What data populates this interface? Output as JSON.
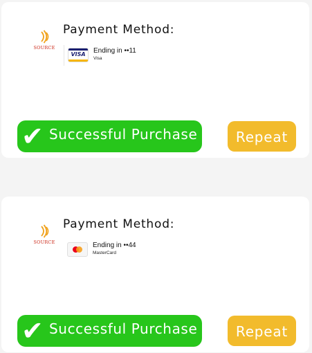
{
  "orders": [
    {
      "logo_text": "SOURCE",
      "title": "Payment Method:",
      "card_icon": "visa-card-icon",
      "card_icon_text": "VISA",
      "ending": "Ending in ••11",
      "brand": "Visa",
      "status": "Successful Purchase",
      "status_icon": "checkmark-icon",
      "repeat_label": "Repeat"
    },
    {
      "logo_text": "SOURCE",
      "title": "Payment Method:",
      "card_icon": "mastercard-icon",
      "ending": "Ending in ••44",
      "brand": "MasterCard",
      "status": "Successful Purchase",
      "status_icon": "checkmark-icon",
      "repeat_label": "Repeat"
    }
  ],
  "colors": {
    "success": "#27c61b",
    "repeat": "#f2bb2c",
    "logo": "#cc2a1a"
  }
}
